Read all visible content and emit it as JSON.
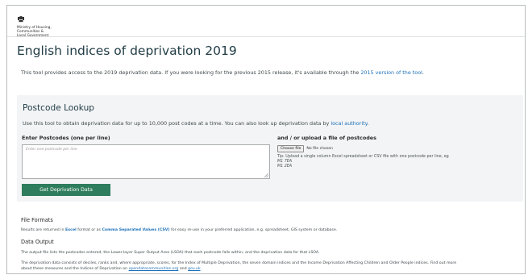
{
  "header": {
    "logo_lines": [
      "Ministry of Housing,",
      "Communities &",
      "Local Government"
    ],
    "crest_icon": "royal-crest-icon"
  },
  "title": "English indices of deprivation 2019",
  "intro": {
    "text": "This tool provides access to the 2019 deprivation data. If you were looking for the previous 2015 release, it's available through the",
    "link": "2015 version of the tool",
    "end": "."
  },
  "lookup": {
    "title": "Postcode Lookup",
    "desc": "Use this tool to obtain deprivation data for up to 10,000 post codes at a time. You can also look up deprivation data by",
    "desc_link": "local authority",
    "desc_end": ".",
    "postcodes_label": "Enter Postcodes (one per line)",
    "postcodes_placeholder": "Enter one postcode per line",
    "upload_label": "and / or upload a file of postcodes",
    "choose_file": "Choose file",
    "no_file": "No file chosen",
    "tip": "Tip: Upload a single column Excel spreadsheet or CSV file with one postcode per line, eg",
    "tip_examples": [
      "M1 7EA",
      "M1 2EA"
    ],
    "submit": "Get Deprivation Data"
  },
  "file_formats": {
    "heading": "File Formats",
    "t1": "Results are returned in",
    "excel": "Excel",
    "t2": "format or as",
    "csv": "Comma Separated Values (CSV)",
    "t3": "for easy re-use in your preferred application, e.g. spreadsheet, GIS system or database."
  },
  "data_output": {
    "heading": "Data Output",
    "p1": "The output file lists the postcodes entered, the Lower-layer Super Output Area (LSOA) that each postcode falls within, and the deprivation data for that LSOA.",
    "p2": "The deprivation data consists of deciles, ranks and, where appropriate, scores, for the Index of Multiple Deprivation, the seven domain indices and the Income Deprivation Affecting Children and Older People indices. Find out more",
    "p3_a": "about these measures and the Indices of Deprivation on",
    "p3_link1": "opendatacommunities.org",
    "p3_b": "and",
    "p3_link2": "gov.uk",
    "p3_c": "."
  }
}
